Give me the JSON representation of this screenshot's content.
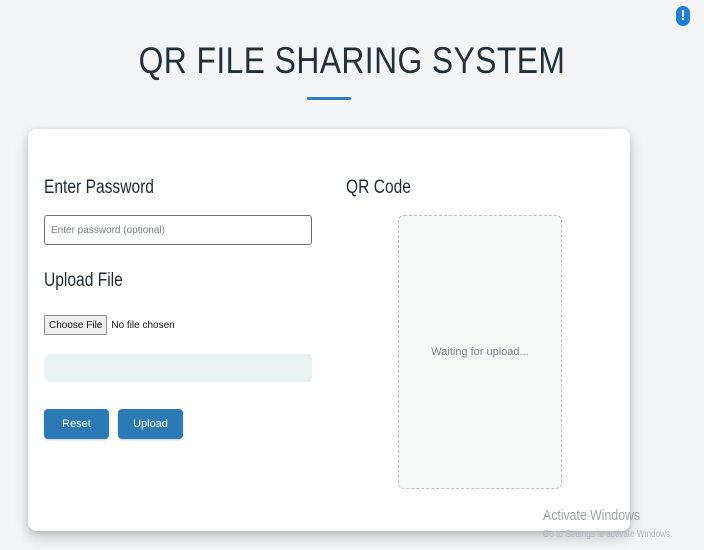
{
  "alert_icon": "exclamation-icon",
  "header": {
    "title": "QR FILE SHARING SYSTEM"
  },
  "form": {
    "password_label": "Enter Password",
    "password_placeholder": "Enter password (optional)",
    "password_value": "",
    "upload_label": "Upload File",
    "choose_file_button": "Choose File",
    "file_status": "No file chosen",
    "upload_progress": 0,
    "reset_button": "Reset",
    "upload_button": "Upload"
  },
  "qr": {
    "label": "QR Code",
    "status": "Waiting for upload..."
  },
  "watermark": {
    "title": "Activate Windows",
    "subtitle": "Go to Settings to activate Windows."
  },
  "colors": {
    "accent": "#2b79b5",
    "background": "#f3f5f7",
    "progress_track": "#e9f2f3"
  }
}
